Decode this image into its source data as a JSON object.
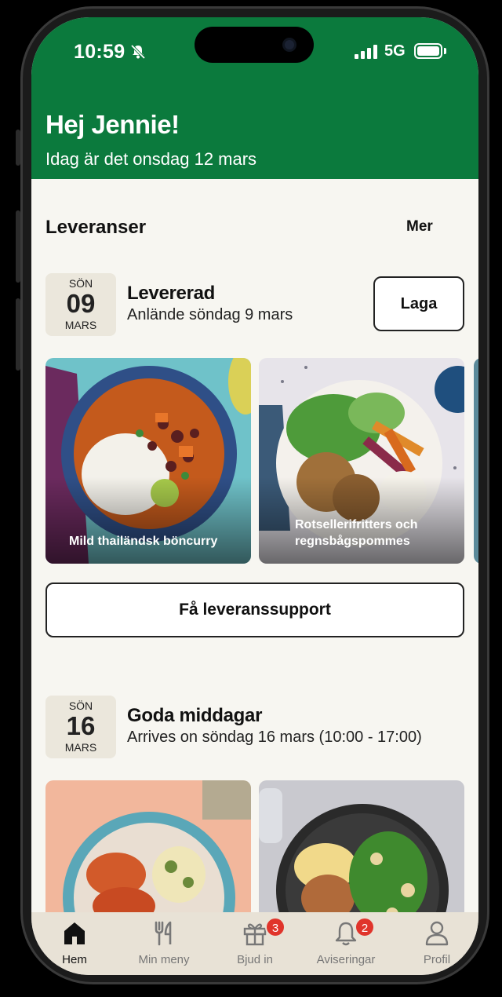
{
  "status_bar": {
    "time": "10:59",
    "network": "5G"
  },
  "header": {
    "greeting": "Hej Jennie!",
    "date_line": "Idag är det onsdag 12 mars"
  },
  "deliveries": {
    "title": "Leveranser",
    "more_label": "Mer",
    "items": [
      {
        "date": {
          "dow": "SÖN",
          "day": "09",
          "month": "MARS"
        },
        "status": "Levererad",
        "subtitle": "Anlände söndag 9 mars",
        "action_label": "Laga",
        "meals": [
          "Mild thailändsk böncurry",
          "Rotsellerifritters och regnsbågspommes"
        ]
      },
      {
        "date": {
          "dow": "SÖN",
          "day": "16",
          "month": "MARS"
        },
        "status": "Goda middagar",
        "subtitle": "Arrives on söndag 16 mars (10:00 - 17:00)",
        "meals": []
      }
    ],
    "support_label": "Få leveranssupport"
  },
  "colors": {
    "brand_green": "#0b7a3d",
    "background": "#f7f6f1",
    "badge": "#e0342b"
  },
  "tabbar": {
    "items": [
      {
        "label": "Hem",
        "icon": "home-icon",
        "active": true
      },
      {
        "label": "Min meny",
        "icon": "cutlery-icon"
      },
      {
        "label": "Bjud in",
        "icon": "gift-icon",
        "badge": "3"
      },
      {
        "label": "Aviseringar",
        "icon": "bell-icon",
        "badge": "2"
      },
      {
        "label": "Profil",
        "icon": "person-icon"
      }
    ]
  }
}
